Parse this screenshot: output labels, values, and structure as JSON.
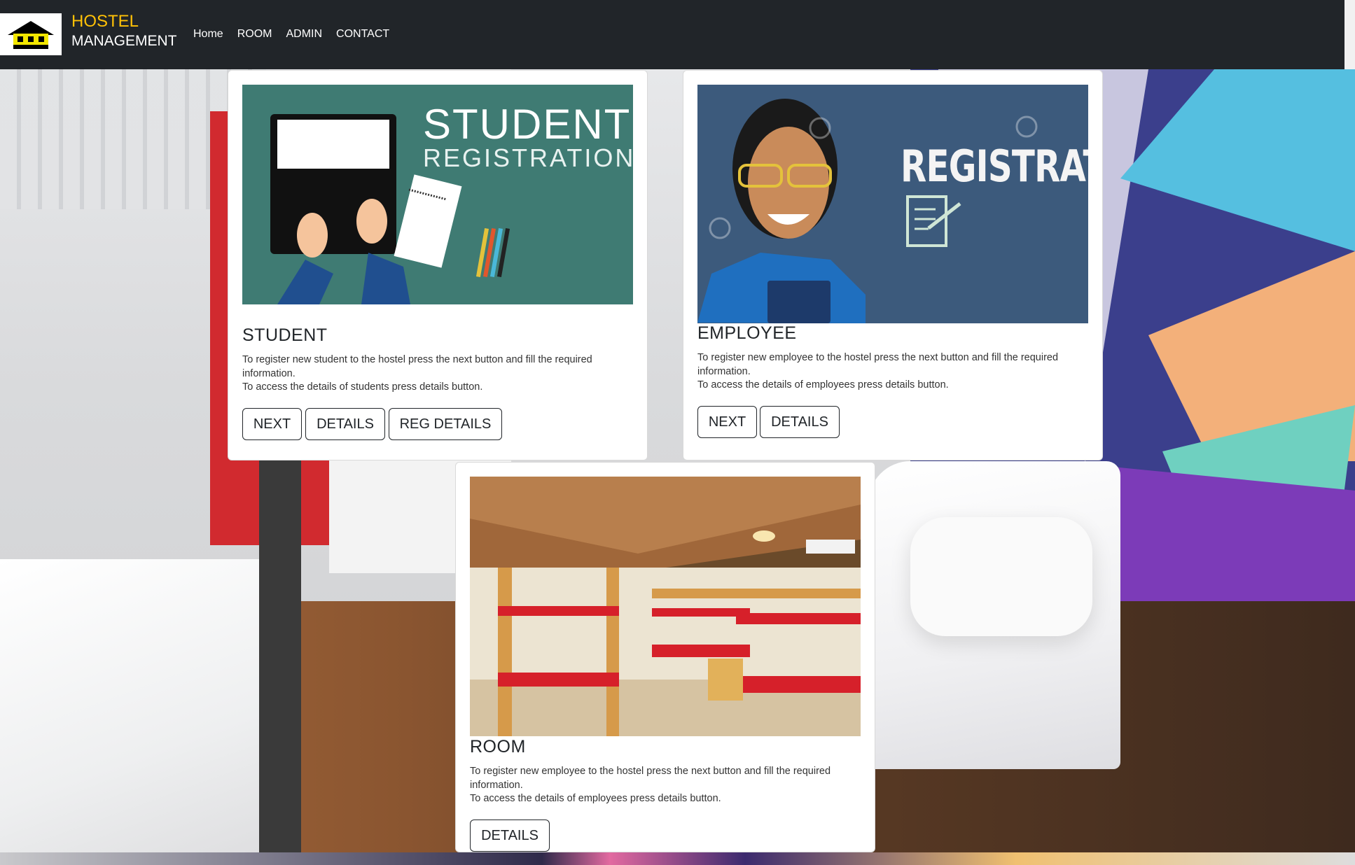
{
  "nav": {
    "brand_line1": "HOSTEL",
    "brand_line2": "MANAGEMENT",
    "links": [
      "Home",
      "ROOM",
      "ADMIN",
      "CONTACT"
    ]
  },
  "student": {
    "image_title": "STUDENT",
    "image_subtitle": "REGISTRATION",
    "heading": "STUDENT",
    "desc_line1": "To register new student to the hostel press the next button and fill the required information.",
    "desc_line2": "To access the details of students press details button.",
    "buttons": [
      "NEXT",
      "DETAILS",
      "REG DETAILS"
    ]
  },
  "employee": {
    "image_title": "REGISTRATION",
    "heading": "EMPLOYEE",
    "desc_line1": "To register new employee to the hostel press the next button and fill the required information.",
    "desc_line2": "To access the details of employees press details button.",
    "buttons": [
      "NEXT",
      "DETAILS"
    ]
  },
  "room": {
    "heading": "ROOM",
    "desc_line1": "To register new employee to the hostel press the next button and fill the required information.",
    "desc_line2": "To access the details of employees press details button.",
    "buttons": [
      "DETAILS"
    ]
  },
  "colors": {
    "navbar": "#212529",
    "brand_accent": "#ffc107",
    "card_bg": "#ffffff"
  },
  "icons": {
    "logo": "hostel-building-icon"
  }
}
